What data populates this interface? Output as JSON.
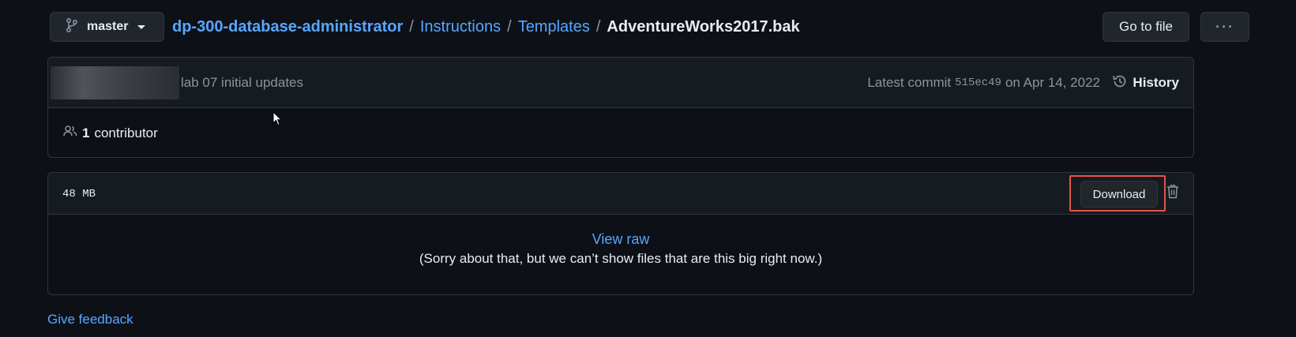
{
  "branch": {
    "label": "master"
  },
  "breadcrumb": {
    "repo": "dp-300-database-administrator",
    "sep": "/",
    "folders": [
      "Instructions",
      "Templates"
    ],
    "file": "AdventureWorks2017.bak"
  },
  "toolbar": {
    "goto_label": "Go to file",
    "more_label": "···"
  },
  "commit": {
    "message": "lab 07 initial updates",
    "latest_prefix": "Latest commit",
    "sha": "515ec49",
    "date_text": "on Apr 14, 2022",
    "history_label": "History"
  },
  "contributors": {
    "count": "1",
    "label": "contributor"
  },
  "file": {
    "size": "48 MB",
    "download_label": "Download",
    "view_raw_label": "View raw",
    "too_big_message": "(Sorry about that, but we can’t show files that are this big right now.)"
  },
  "footer": {
    "feedback_label": "Give feedback"
  },
  "colors": {
    "accent": "#58a6ff",
    "highlight": "#e5534b",
    "background": "#0d1117"
  }
}
